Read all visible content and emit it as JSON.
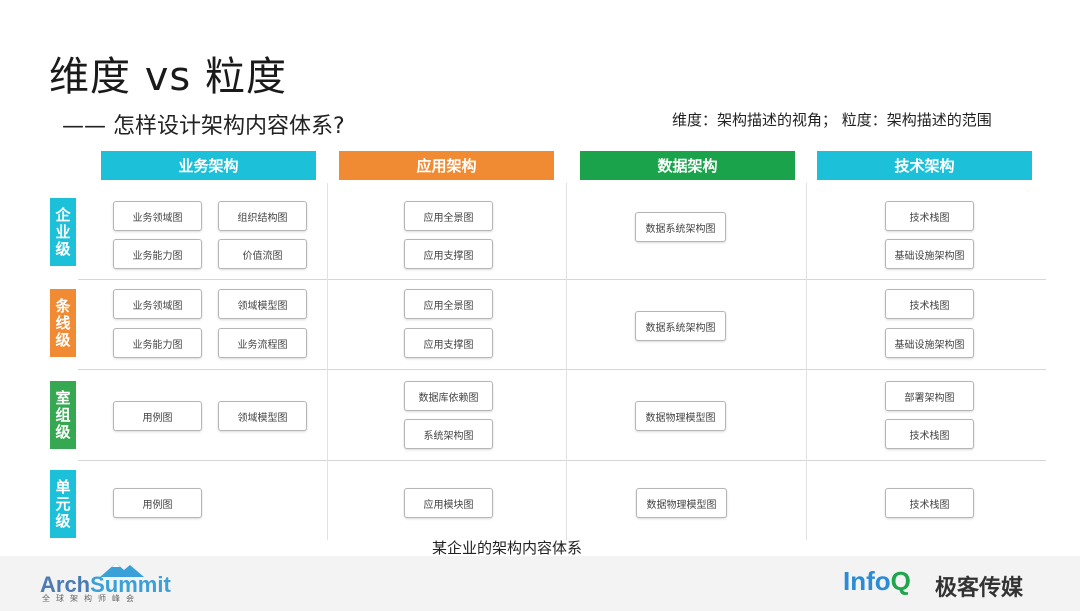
{
  "title": "维度 vs 粒度",
  "subtitle": "—— 怎样设计架构内容体系?",
  "legend_note": "维度：架构描述的视角；  粒度：架构描述的范围",
  "columns": [
    {
      "label": "业务架构",
      "color": "#1cc1d9"
    },
    {
      "label": "应用架构",
      "color": "#f08a33"
    },
    {
      "label": "数据架构",
      "color": "#1aa34a"
    },
    {
      "label": "技术架构",
      "color": "#1cc1d9"
    }
  ],
  "rows": [
    {
      "label": "企业级",
      "color": "#1cc1d9"
    },
    {
      "label": "条线级",
      "color": "#f08a33"
    },
    {
      "label": "室组级",
      "color": "#35a851"
    },
    {
      "label": "单元级",
      "color": "#1cc1d9"
    }
  ],
  "boxes": {
    "r1": {
      "biz": [
        "业务领域图",
        "组织结构图",
        "业务能力图",
        "价值流图"
      ],
      "app": [
        "应用全景图",
        "应用支撑图"
      ],
      "data": [
        "数据系统架构图"
      ],
      "tech": [
        "技术栈图",
        "基础设施架构图"
      ]
    },
    "r2": {
      "biz": [
        "业务领域图",
        "领域模型图",
        "业务能力图",
        "业务流程图"
      ],
      "app": [
        "应用全景图",
        "应用支撑图"
      ],
      "data": [
        "数据系统架构图"
      ],
      "tech": [
        "技术栈图",
        "基础设施架构图"
      ]
    },
    "r3": {
      "biz": [
        "用例图",
        "领域模型图"
      ],
      "app": [
        "数据库依赖图",
        "系统架构图"
      ],
      "data": [
        "数据物理模型图"
      ],
      "tech": [
        "部署架构图",
        "技术栈图"
      ]
    },
    "r4": {
      "biz": [
        "用例图"
      ],
      "app": [
        "应用模块图"
      ],
      "data": [
        "数据物理模型图"
      ],
      "tech": [
        "技术栈图"
      ]
    }
  },
  "caption": "某企业的架构内容体系",
  "footer": {
    "archsummit_a": "Arch",
    "archsummit_b": "Summit",
    "archsummit_sub": "全球架构师峰会",
    "infoq_a": "Info",
    "infoq_b": "Q",
    "geek": "极客传媒"
  }
}
